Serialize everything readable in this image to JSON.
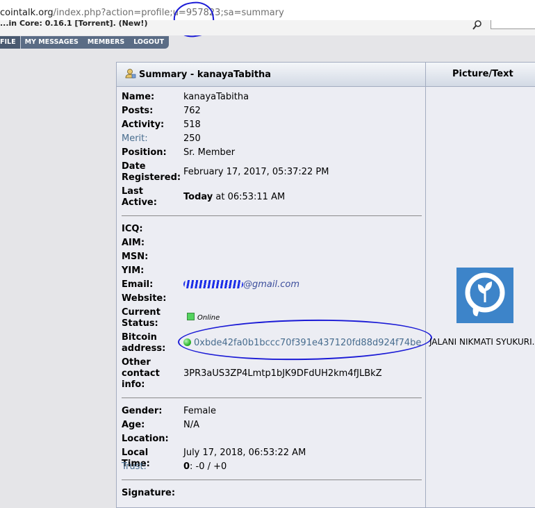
{
  "browser": {
    "url_host": "cointalk.org",
    "url_path": "/index.php?action=profile;u=957823;sa=summary"
  },
  "forum_strip": {
    "text": "...in Core: 0.16.1  [Torrent]. (New!)"
  },
  "menu": {
    "items": [
      "FILE",
      "MY MESSAGES",
      "MEMBERS",
      "LOGOUT"
    ]
  },
  "profile": {
    "title": "Summary - kanayaTabitha",
    "picture_header": "Picture/Text",
    "section1": [
      {
        "label": "Name:",
        "value": "kanayaTabitha"
      },
      {
        "label": "Posts:",
        "value": "762"
      },
      {
        "label": "Activity:",
        "value": "518"
      },
      {
        "label": "Merit:",
        "value": "250"
      },
      {
        "label": "Position:",
        "value": "Sr. Member"
      },
      {
        "label": "Date Registered:",
        "value": "February 17, 2017, 05:37:22 PM"
      },
      {
        "label": "Last Active:",
        "value_bold": "Today",
        "value": " at 06:53:11 AM"
      }
    ],
    "section2": {
      "icq_label": "ICQ:",
      "aim_label": "AIM:",
      "msn_label": "MSN:",
      "yim_label": "YIM:",
      "email_label": "Email:",
      "email_value": "@gmail.com",
      "website_label": "Website:",
      "status_label": "Current Status:",
      "status_value": "Online",
      "bitcoin_label": "Bitcoin address:",
      "bitcoin_value": "0xbde42fa0b1bccc70f391e437120fd88d924f74be",
      "other_label": "Other contact info:",
      "other_value": "3PR3aUS3ZP4Lmtp1bJK9DFdUH2km4fJLBkZ"
    },
    "section3": [
      {
        "label": "Gender:",
        "value": "Female"
      },
      {
        "label": "Age:",
        "value": "N/A"
      },
      {
        "label": "Location:",
        "value": ""
      },
      {
        "label": "Local Time:",
        "value": "July 17, 2018, 06:53:22 AM"
      },
      {
        "label": "Trust:",
        "value_bold": "0",
        "value": ": -0 / +0"
      }
    ],
    "signature_label": "Signature:",
    "avatar_caption": "JALANI NIKMATI SYUKURI..."
  },
  "colors": {
    "annotation": "#1b1bd6",
    "link": "#476c8e",
    "avatar_bg": "#3d84c9"
  }
}
